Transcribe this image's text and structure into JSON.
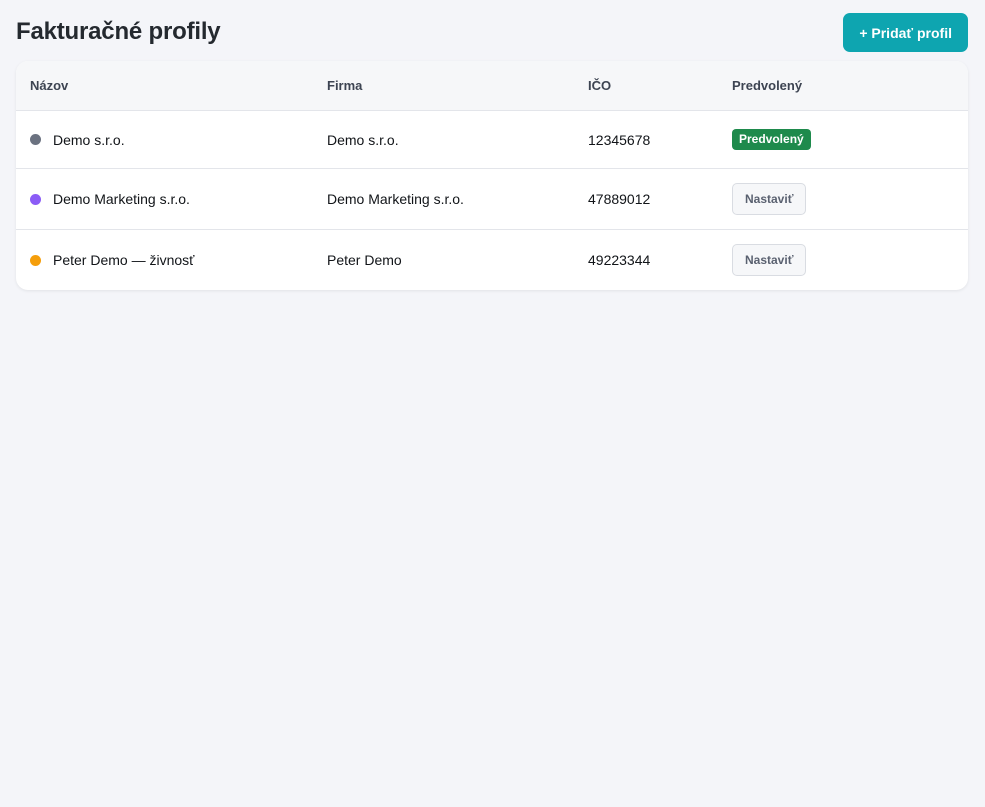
{
  "page": {
    "title": "Fakturačné profily",
    "add_button_label": "+ Pridať profil"
  },
  "table": {
    "headers": {
      "name": "Názov",
      "firm": "Firma",
      "ico": "IČO",
      "default": "Predvolený"
    },
    "rows": [
      {
        "name": "Demo s.r.o.",
        "firm": "Demo s.r.o.",
        "ico": "12345678",
        "dot_color": "#6b7280",
        "is_default": true,
        "default_badge": "Predvolený"
      },
      {
        "name": "Demo Marketing s.r.o.",
        "firm": "Demo Marketing s.r.o.",
        "ico": "47889012",
        "dot_color": "#8b5cf6",
        "is_default": false,
        "set_label": "Nastaviť"
      },
      {
        "name": "Peter Demo — živnosť",
        "firm": "Peter Demo",
        "ico": "49223344",
        "dot_color": "#f59e0b",
        "is_default": false,
        "set_label": "Nastaviť"
      }
    ]
  },
  "colors": {
    "accent": "#0ea5b0",
    "default_badge_bg": "#1e8a4c",
    "background": "#f4f5f9"
  }
}
